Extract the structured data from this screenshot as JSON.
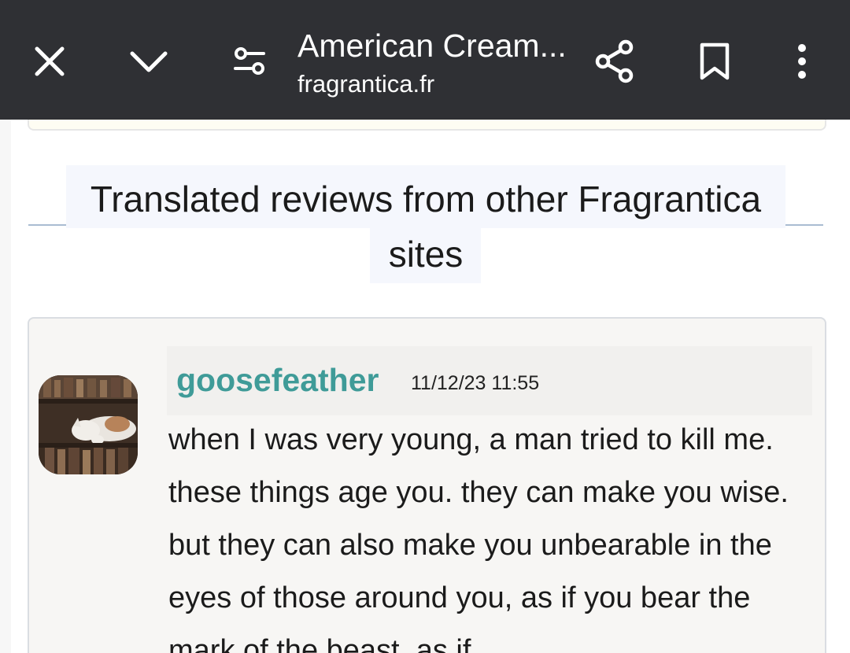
{
  "browser": {
    "title": "American Cream...",
    "domain": "fragrantica.fr",
    "icons": [
      "close-icon",
      "chevron-down-icon",
      "tune-icon",
      "share-icon",
      "bookmark-icon",
      "more-vert-icon"
    ]
  },
  "section": {
    "heading": "Translated reviews from other Fragrantica sites"
  },
  "review": {
    "username": "goosefeather",
    "timestamp": "11/12/23 11:55",
    "text": "when I was very young, a man tried to kill me. these things age you. they can make you wise. but they can also make you unbearable in the eyes of those around you, as if you bear the mark of the beast. as if"
  },
  "colors": {
    "topbar": "#2f3034",
    "username": "#3f9b98",
    "divider": "#a9bcd2"
  }
}
